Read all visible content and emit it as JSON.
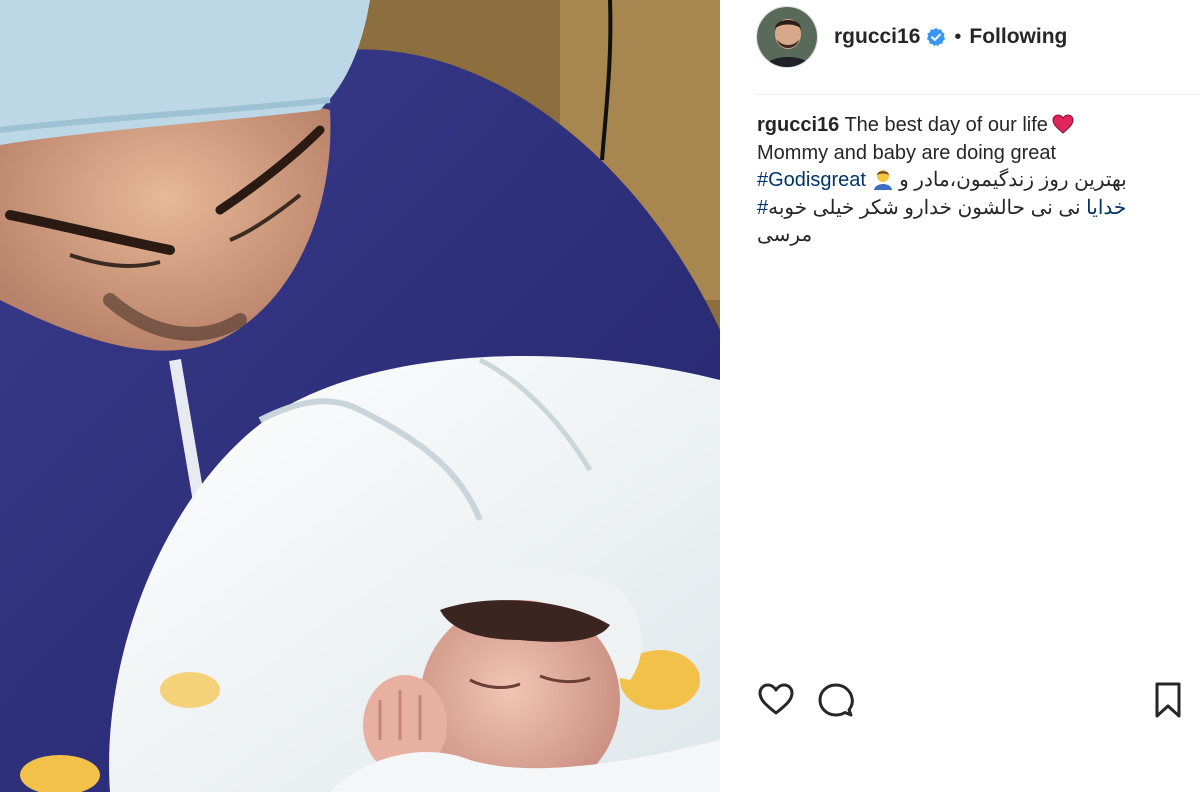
{
  "post": {
    "photo": {
      "description_icon": "newborn-photo"
    },
    "author": {
      "username": "rgucci16",
      "verified": true,
      "separator": "•",
      "follow_status": "Following"
    },
    "caption": {
      "username": "rgucci16",
      "line1_text": "The best day of our life",
      "line1_emoji": "red-heart",
      "line2_text": "Mommy and baby are doing great",
      "line3_hashtag": "#Godisgreat",
      "line3_emoji": "person-bowing",
      "line3_persian": "بهترین روز زندگیمون،مادر و",
      "line4_persian": "نی نی حالشون خدارو شکر خیلی خوبه",
      "line4_hashtag": "#خدایا",
      "line5_persian": "مرسی"
    },
    "actions": {
      "like_icon": "heart-outline-icon",
      "comment_icon": "comment-icon",
      "save_icon": "bookmark-icon"
    },
    "colors": {
      "text": "#262626",
      "hashtag": "#003569",
      "verified_badge": "#3897f0",
      "heart": "#e0245e"
    }
  }
}
